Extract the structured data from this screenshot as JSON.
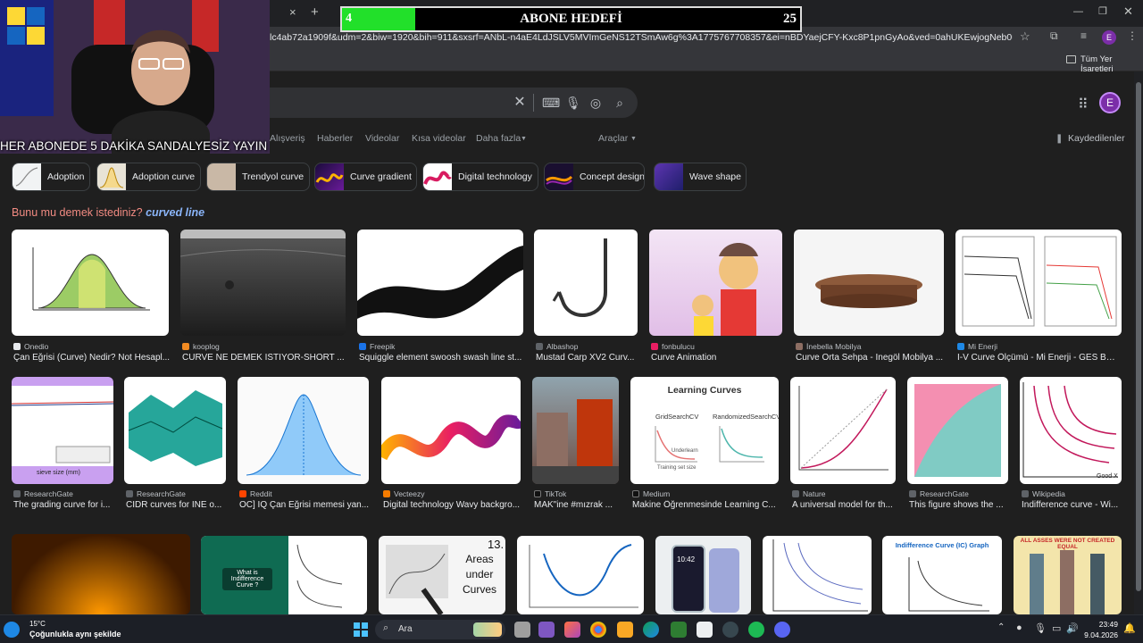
{
  "browser": {
    "tab_close": "×",
    "tab_new": "+",
    "url": "lc4ab72a1909f&udm=2&biw=1920&bih=911&sxsrf=ANbL-n4aE4LdJSLV5MVImGeNS12TSmAw6g%3A1775767708357&ei=nBDYaejCFY-Kxc8P1pnGyAo&ved=0ahUKEwjogNeb0uGTAxUPRfEDHdaMEak...",
    "bookmarks_label": "Tüm Yer İşaretleri",
    "profile_initial": "E"
  },
  "search": {
    "tabs": [
      "Alışveriş",
      "Haberler",
      "Videolar",
      "Kısa videolar",
      "Daha fazla"
    ],
    "tools": "Araçlar",
    "saved": "Kaydedilenler",
    "suggest_prefix": "Bunu mu demek istediniz?",
    "suggest_term": "curved line"
  },
  "chips": [
    {
      "label": "Adoption"
    },
    {
      "label": "Adoption curve"
    },
    {
      "label": "Trendyol curve"
    },
    {
      "label": "Curve gradient"
    },
    {
      "label": "Digital technology"
    },
    {
      "label": "Concept design"
    },
    {
      "label": "Wave shape"
    }
  ],
  "results_row1": [
    {
      "source": "Onedio",
      "title": "Çan Eğrisi (Curve) Nedir? Not Hesapl...",
      "color": "#2c2c2c"
    },
    {
      "source": "kooplog",
      "title": "CURVE NE DEMEK İSTİYOR-SHORT ...",
      "color": "#f28b22"
    },
    {
      "source": "Freepik",
      "title": "Squiggle element swoosh swash line st...",
      "color": "#1a73e8"
    },
    {
      "source": "Albashop",
      "title": "Mustad Carp XV2 Curv...",
      "color": "#5f6368"
    },
    {
      "source": "fonbulucu",
      "title": "Curve Animation",
      "color": "#e91e63"
    },
    {
      "source": "İnebella Mobilya",
      "title": "Curve Orta Sehpa - İnegöl Mobilya ...",
      "color": "#8d6e63"
    },
    {
      "source": "Mi Enerji",
      "title": "I-V Curve Ölçümü - Mi Enerji - GES Ba...",
      "color": "#1e88e5"
    }
  ],
  "results_row2": [
    {
      "source": "ResearchGate",
      "title": "The grading curve for i...",
      "color": "#5f6368"
    },
    {
      "source": "ResearchGate",
      "title": "CIDR curves for INE o...",
      "color": "#5f6368"
    },
    {
      "source": "Reddit",
      "title": "OC] IQ Çan Eğrisi memesi yan...",
      "color": "#ff4500"
    },
    {
      "source": "Vecteezy",
      "title": "Digital technology Wavy backgro...",
      "color": "#f57c00"
    },
    {
      "source": "TikTok",
      "title": "MAK\"ine #mızrak ...",
      "color": "#111111"
    },
    {
      "source": "Medium",
      "title": "Makine Öğrenmesinde Learning C...",
      "color": "#111111"
    },
    {
      "source": "Nature",
      "title": "A universal model for th...",
      "color": "#5f6368"
    },
    {
      "source": "ResearchGate",
      "title": "This figure shows the ...",
      "color": "#5f6368"
    },
    {
      "source": "Wikipedia",
      "title": "Indifference curve - Wi...",
      "color": "#5f6368"
    }
  ],
  "image_text": {
    "learning_title": "Learning Curves",
    "grid_search": "GridSearchCV",
    "random_search": "RandomizedSearchCV",
    "underlearn": "Underlearn",
    "training_size": "Training set size",
    "indiff_title": "What is Indifference Curve ?",
    "areas": "Areas under Curves",
    "areas_num": "13.",
    "ic_graph": "Indifference Curve (IC) Graph",
    "asses": "ALL ASSES WERE NOT CREATED EQUAL",
    "good_x": "Good X",
    "phone_time": "10:42",
    "sieve": "sieve size (mm)"
  },
  "stream": {
    "goal_title": "ABONE HEDEFİ",
    "goal_current": "4",
    "goal_target": "25",
    "goal_progress": 0.16,
    "caption": "HER ABONEDE 5 DAKİKA SANDALYESİZ YAYIN"
  },
  "taskbar": {
    "temp": "15°C",
    "weather": "Çoğunlukla aynı şekilde",
    "search": "Ara",
    "time": "23:49",
    "date": "9.04.2026"
  }
}
